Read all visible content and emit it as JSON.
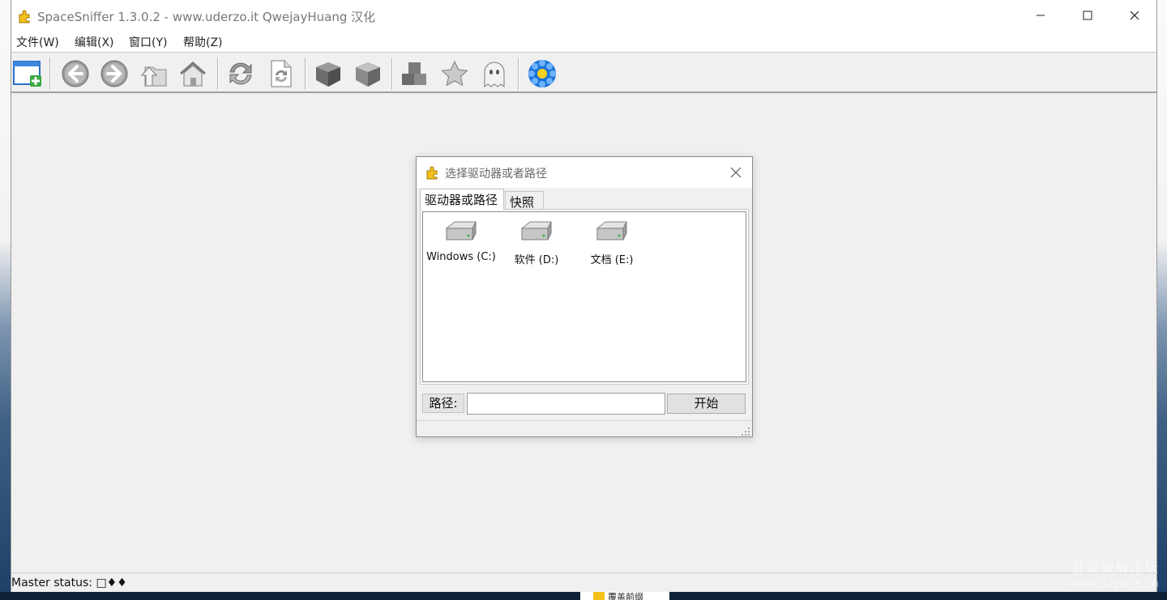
{
  "window": {
    "title": "SpaceSniffer 1.3.0.2 - www.uderzo.it  QwejayHuang 汉化",
    "controls": {
      "minimize": "—",
      "maximize": "☐",
      "close": "✕"
    }
  },
  "menu": [
    {
      "label": "文件(W)"
    },
    {
      "label": "编辑(X)"
    },
    {
      "label": "窗口(Y)"
    },
    {
      "label": "帮助(Z)"
    }
  ],
  "toolbar": {
    "buttons": [
      {
        "icon": "new-window-icon"
      },
      {
        "icon": "back-arrow-icon"
      },
      {
        "icon": "forward-arrow-icon"
      },
      {
        "icon": "up-folder-icon"
      },
      {
        "icon": "home-icon"
      },
      {
        "icon": "refresh-icon"
      },
      {
        "icon": "refresh-page-icon"
      },
      {
        "icon": "cube-icon"
      },
      {
        "icon": "cube-outline-icon"
      },
      {
        "icon": "blocks-icon"
      },
      {
        "icon": "star-icon"
      },
      {
        "icon": "ghost-icon"
      },
      {
        "icon": "gear-flower-icon"
      }
    ]
  },
  "dialog": {
    "title": "选择驱动器或者路径",
    "tabs": [
      {
        "label": "驱动器或路径",
        "active": true
      },
      {
        "label": "快照",
        "active": false
      }
    ],
    "drives": [
      {
        "label": "Windows (C:)",
        "icon": "hard-drive-icon"
      },
      {
        "label": "软件 (D:)",
        "icon": "hard-drive-icon"
      },
      {
        "label": "文档 (E:)",
        "icon": "hard-drive-icon"
      }
    ],
    "path_label": "路径:",
    "path_value": "",
    "start_label": "开始"
  },
  "status": {
    "text": "Master status: □♦♦"
  },
  "watermark": {
    "line1": "吾爱破解论坛",
    "line2": "www.52pojie.cn"
  },
  "taskbar_peek": {
    "text": "覆盖前缀"
  },
  "colors": {
    "window_bg": "#f0f0f0",
    "titlebar_bg": "#ffffff",
    "accent_blue": "#1a73d9",
    "folder_yellow": "#f3c21a"
  }
}
